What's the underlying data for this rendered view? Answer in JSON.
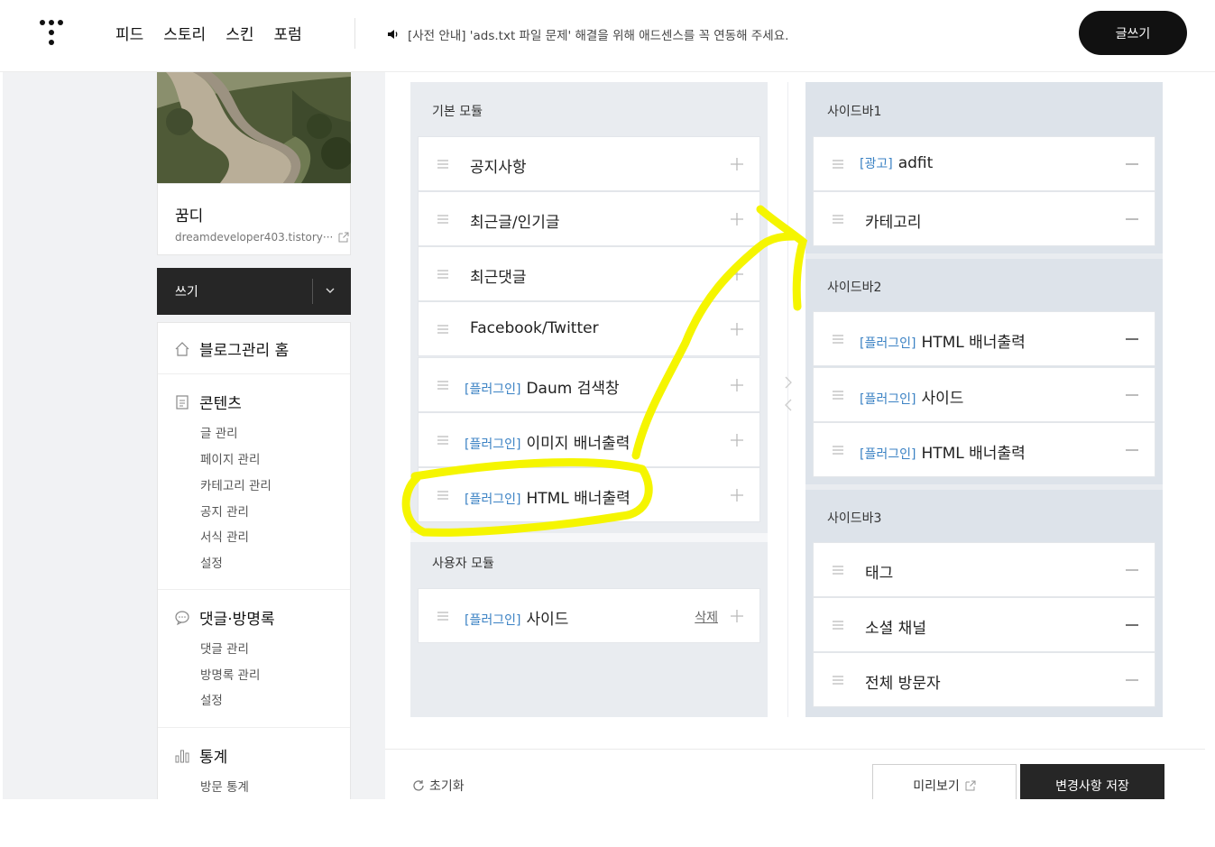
{
  "header": {
    "nav": [
      "피드",
      "스토리",
      "스킨",
      "포럼"
    ],
    "notice": "[사전 안내] 'ads.txt 파일 문제' 해결을 위해 애드센스를 꼭 연동해 주세요.",
    "write_button": "글쓰기"
  },
  "blog": {
    "name": "꿈디",
    "url": "dreamdeveloper403.tistory···"
  },
  "write_bar": {
    "label": "쓰기"
  },
  "menu": {
    "home": "블로그관리 홈",
    "contents": {
      "title": "콘텐츠",
      "items": [
        "글 관리",
        "페이지 관리",
        "카테고리 관리",
        "공지 관리",
        "서식 관리",
        "설정"
      ]
    },
    "comments": {
      "title": "댓글·방명록",
      "items": [
        "댓글 관리",
        "방명록 관리",
        "설정"
      ]
    },
    "stats": {
      "title": "통계",
      "items": [
        "방문 통계"
      ]
    }
  },
  "basic_modules": {
    "label": "기본 모듈",
    "items": [
      {
        "tag": "",
        "text": "공지사항"
      },
      {
        "tag": "",
        "text": "최근글/인기글"
      },
      {
        "tag": "",
        "text": "최근댓글"
      },
      {
        "tag": "",
        "text": "Facebook/Twitter"
      },
      {
        "tag": "[플러그인]",
        "text": "Daum 검색창"
      },
      {
        "tag": "[플러그인]",
        "text": "이미지 배너출력"
      },
      {
        "tag": "[플러그인]",
        "text": "HTML 배너출력"
      }
    ]
  },
  "user_modules": {
    "label": "사용자 모듈",
    "items": [
      {
        "tag": "[플러그인]",
        "text": "사이드",
        "delete": "삭제"
      }
    ]
  },
  "sidebars": [
    {
      "label": "사이드바1",
      "items": [
        {
          "tag": "[광고]",
          "text": "adfit"
        },
        {
          "tag": "",
          "text": "카테고리"
        }
      ]
    },
    {
      "label": "사이드바2",
      "items": [
        {
          "tag": "[플러그인]",
          "text": "HTML 배너출력"
        },
        {
          "tag": "[플러그인]",
          "text": "사이드"
        },
        {
          "tag": "[플러그인]",
          "text": "HTML 배너출력"
        }
      ]
    },
    {
      "label": "사이드바3",
      "items": [
        {
          "tag": "",
          "text": "태그"
        },
        {
          "tag": "",
          "text": "소셜 채널"
        },
        {
          "tag": "",
          "text": "전체 방문자"
        }
      ]
    }
  ],
  "footer": {
    "reset": "초기화",
    "preview": "미리보기",
    "save": "변경사항 저장"
  },
  "colors": {
    "accent_tag": "#3b82c4",
    "highlight": "#f5f500",
    "dark": "#262626"
  },
  "icons": [
    "tistory-logo-icon",
    "speaker-icon",
    "external-link-icon",
    "chevron-down-icon",
    "home-icon",
    "document-icon",
    "chat-icon",
    "bar-chart-icon",
    "drag-handle-icon",
    "plus-icon",
    "minus-icon",
    "refresh-icon"
  ]
}
